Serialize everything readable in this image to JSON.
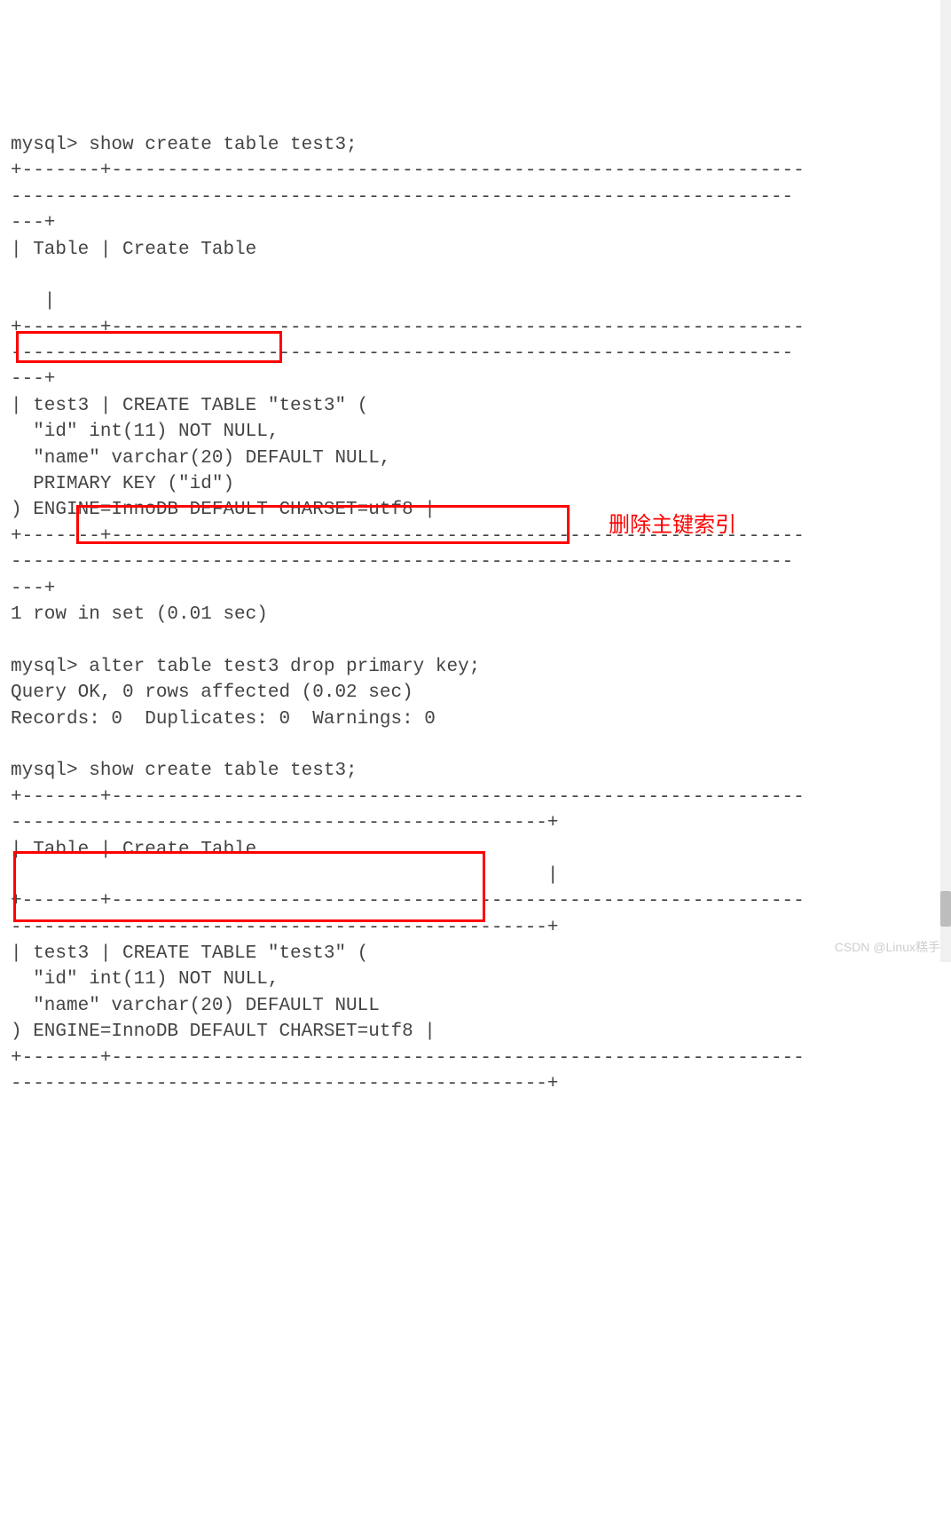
{
  "lines": {
    "l0": "mysql> show create table test3;",
    "l1": "+-------+--------------------------------------------------------------",
    "l2": "----------------------------------------------------------------------",
    "l3": "---+",
    "l4": "| Table | Create Table                                                 ",
    "l5": "                                                                     ",
    "l6": "   |",
    "l7": "+-------+--------------------------------------------------------------",
    "l8": "----------------------------------------------------------------------",
    "l9": "---+",
    "l10": "| test3 | CREATE TABLE \"test3\" (",
    "l11": "  \"id\" int(11) NOT NULL,",
    "l12": "  \"name\" varchar(20) DEFAULT NULL,",
    "l13": "  PRIMARY KEY (\"id\")",
    "l14": ") ENGINE=InnoDB DEFAULT CHARSET=utf8 |",
    "l15": "+-------+--------------------------------------------------------------",
    "l16": "----------------------------------------------------------------------",
    "l17": "---+",
    "l18": "1 row in set (0.01 sec)",
    "l19": "",
    "l20": "mysql> alter table test3 drop primary key;",
    "l21": "Query OK, 0 rows affected (0.02 sec)",
    "l22": "Records: 0  Duplicates: 0  Warnings: 0",
    "l23": "",
    "l24": "mysql> show create table test3;",
    "l25": "+-------+--------------------------------------------------------------",
    "l26": "------------------------------------------------+",
    "l27": "| Table | Create Table                                                 ",
    "l28": "                                                |",
    "l29": "+-------+--------------------------------------------------------------",
    "l30": "------------------------------------------------+",
    "l31": "| test3 | CREATE TABLE \"test3\" (",
    "l32": "  \"id\" int(11) NOT NULL,",
    "l33": "  \"name\" varchar(20) DEFAULT NULL",
    "l34": ") ENGINE=InnoDB DEFAULT CHARSET=utf8 |",
    "l35": "+-------+--------------------------------------------------------------",
    "l36": "------------------------------------------------+"
  },
  "annotation": {
    "delete_pk": "删除主键索引"
  },
  "watermark": "CSDN @Linux糕手"
}
